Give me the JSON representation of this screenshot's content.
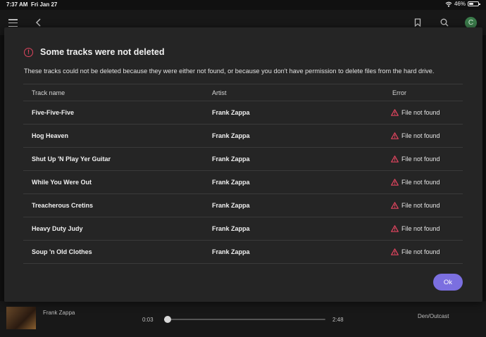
{
  "status_bar": {
    "time": "7:37 AM",
    "date": "Fri Jan 27",
    "battery": "46%"
  },
  "header": {
    "avatar_initial": "C"
  },
  "player": {
    "artist": "Frank Zappa",
    "elapsed": "0:03",
    "duration": "2:48",
    "progress_fraction": 0.02,
    "next_track": "Den/Outcast"
  },
  "dialog": {
    "title": "Some tracks were not deleted",
    "message": "These tracks could not be deleted because they were either not found, or because you don't have permission to delete files from the hard drive.",
    "columns": {
      "track": "Track name",
      "artist": "Artist",
      "error": "Error"
    },
    "rows": [
      {
        "track": "Five-Five-Five",
        "artist": "Frank Zappa",
        "error": "File not found"
      },
      {
        "track": "Hog Heaven",
        "artist": "Frank Zappa",
        "error": "File not found"
      },
      {
        "track": "Shut Up 'N Play Yer Guitar",
        "artist": "Frank Zappa",
        "error": "File not found"
      },
      {
        "track": "While You Were Out",
        "artist": "Frank Zappa",
        "error": "File not found"
      },
      {
        "track": "Treacherous Cretins",
        "artist": "Frank Zappa",
        "error": "File not found"
      },
      {
        "track": "Heavy Duty Judy",
        "artist": "Frank Zappa",
        "error": "File not found"
      },
      {
        "track": "Soup 'n Old Clothes",
        "artist": "Frank Zappa",
        "error": "File not found"
      }
    ],
    "ok_label": "Ok"
  },
  "colors": {
    "accent": "#7b6fe0",
    "error": "#e0455f",
    "dialog_bg": "#252525"
  }
}
